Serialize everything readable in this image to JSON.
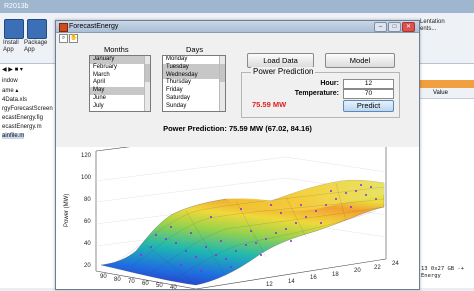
{
  "desktop": {
    "title_fragment": "R2013b",
    "ribbon": {
      "install_label": "Install",
      "install_label2": "App",
      "package_label": "Package",
      "package_label2": "App",
      "right_label": "Lentation",
      "right_label2": "ents..."
    },
    "files": [
      "indow",
      "ame ▴",
      "4Data.xls",
      "rgyForecastScreen",
      "ecastEnergy.fig",
      "ecastEnergy.m",
      "ainfile.m"
    ],
    "workspace_header": "Value",
    "command_text": "13 0x27 GB -+\nEnergy"
  },
  "window": {
    "title": "ForecastEnergy",
    "controls": [
      "–",
      "□",
      "✕"
    ]
  },
  "months": {
    "label": "Months",
    "items": [
      "January",
      "February",
      "March",
      "April",
      "May",
      "June",
      "July"
    ],
    "selected": [
      "January",
      "May"
    ]
  },
  "days": {
    "label": "Days",
    "items": [
      "Monday",
      "Tuesday",
      "Wednesday",
      "Thursday",
      "Friday",
      "Saturday",
      "Sunday"
    ],
    "selected": [
      "Tuesday",
      "Wednesday"
    ]
  },
  "buttons": {
    "load_data": "Load Data",
    "model": "Model",
    "predict": "Predict"
  },
  "prediction": {
    "panel_title": "Power Prediction",
    "hour_label": "Hour:",
    "hour_value": "12",
    "temperature_label": "Temperature:",
    "temperature_value": "70",
    "result": "75.59 MW"
  },
  "plot": {
    "title": "Power Prediction: 75.59 MW (67.02, 84.16)",
    "ylabel": "Power (MW)",
    "z_ticks": [
      "120",
      "100",
      "80",
      "60",
      "40",
      "20"
    ],
    "x_ticks": [
      "90",
      "80",
      "70",
      "60",
      "50",
      "40"
    ],
    "y_ticks": [
      "12",
      "14",
      "16",
      "18",
      "20",
      "22",
      "24"
    ]
  }
}
